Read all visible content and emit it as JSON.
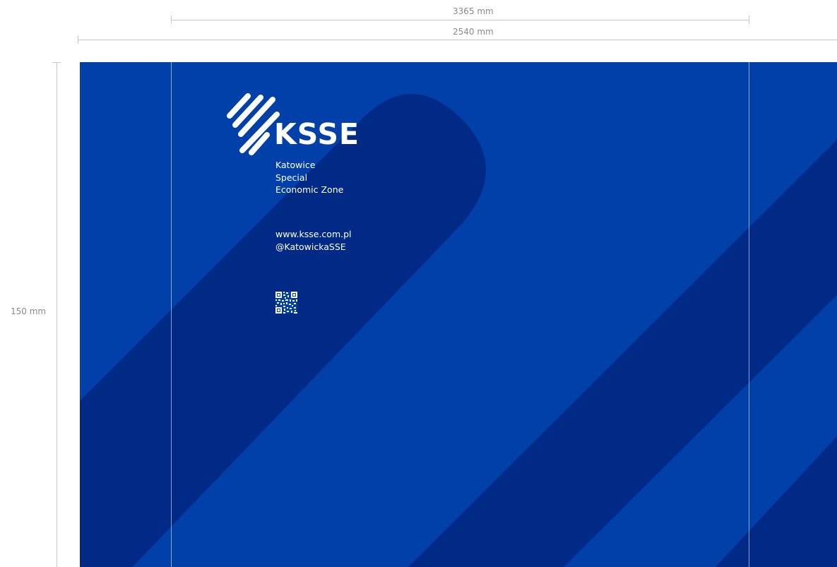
{
  "dimensions": {
    "inner_width_label": "3365 mm",
    "outer_width_label": "2540 mm",
    "height_label": "150 mm"
  },
  "brand": {
    "name": "KSSE",
    "tagline_lines": [
      "Katowice",
      "Special",
      "Economic Zone"
    ]
  },
  "contact": {
    "website": "www.ksse.com.pl",
    "social_handle": "@KatowickaSSE"
  },
  "colors": {
    "background": "#0040a8",
    "dark_stripe": "#002a86",
    "text": "#ffffff"
  },
  "icons": {
    "logo": "diagonal-stripes-logo-icon",
    "qr": "qr-code-icon"
  }
}
